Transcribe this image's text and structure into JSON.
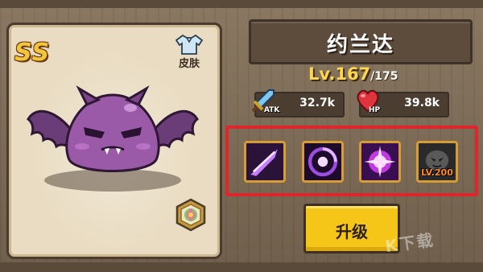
{
  "hero": {
    "name": "约兰达",
    "rarity": "SS",
    "level_current": "Lv.167",
    "level_max": "/175"
  },
  "stats": {
    "atk": {
      "tag": "ATK",
      "value": "32.7k"
    },
    "hp": {
      "tag": "HP",
      "value": "39.8k"
    }
  },
  "buttons": {
    "skin_label": "皮肤",
    "upgrade_label": "升级"
  },
  "skills": [
    {
      "icon": "slash-skill-icon",
      "locked_level": ""
    },
    {
      "icon": "vortex-skill-icon",
      "locked_level": ""
    },
    {
      "icon": "burst-skill-icon",
      "locked_level": ""
    },
    {
      "icon": "shadow-skill-icon",
      "locked_level": "LV.200"
    }
  ],
  "watermark": "K下载",
  "colors": {
    "rarity_gold": "#f3c53a",
    "level_gold": "#ffd54a",
    "upgrade_yellow": "#f5c517",
    "highlight_red": "#e0262c",
    "locked_level_orange": "#ff8a2a"
  }
}
